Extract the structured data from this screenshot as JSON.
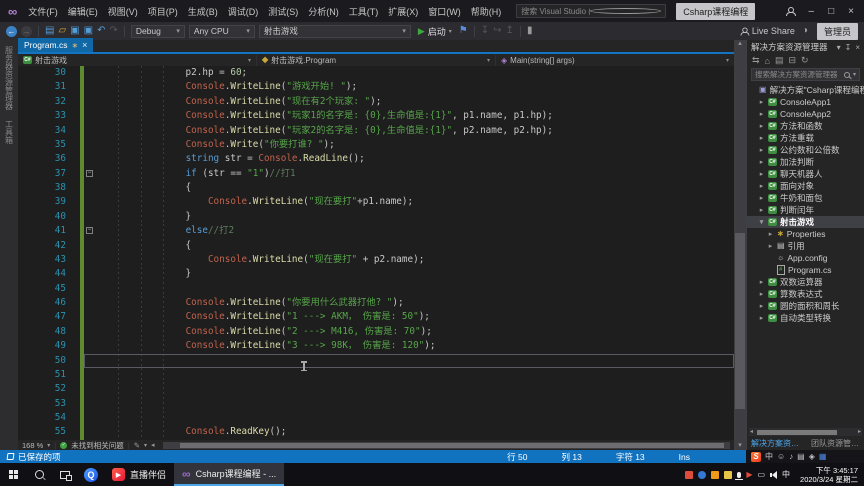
{
  "titlebar": {
    "menus": [
      "文件(F)",
      "编辑(E)",
      "视图(V)",
      "项目(P)",
      "生成(B)",
      "调试(D)",
      "测试(S)",
      "分析(N)",
      "工具(T)",
      "扩展(X)",
      "窗口(W)",
      "帮助(H)"
    ],
    "search_placeholder": "搜索 Visual Studio (Ctrl+Q)",
    "window_title": "Csharp课程编程",
    "minimize": "–",
    "maximize": "□",
    "close": "×"
  },
  "toolbar": {
    "config": "Debug",
    "platform": "Any CPU",
    "startup_project": "射击游戏",
    "start_label": "启动",
    "live_share_label": "Live Share",
    "admin_badge": "管理员"
  },
  "left_tabs": [
    "服务器资源管理器",
    "工具箱"
  ],
  "editor": {
    "tab": "Program.cs",
    "navbar": {
      "project": "射击游戏",
      "type": "射击游戏.Program",
      "member": "Main(string[] args)"
    },
    "zoom_level": "168 %",
    "health": "未找到相关问题",
    "lines": [
      {
        "n": 30,
        "t": [
          [
            "                p2.hp = ",
            "id"
          ],
          [
            "60",
            "num"
          ],
          [
            ";",
            "id"
          ]
        ]
      },
      {
        "n": 31,
        "t": [
          [
            "                ",
            "id"
          ],
          [
            "Console",
            "cls"
          ],
          [
            ".",
            "id"
          ],
          [
            "WriteLine",
            "mth"
          ],
          [
            "(",
            "id"
          ],
          [
            "\"游戏开始! \"",
            "str"
          ],
          [
            ");",
            "id"
          ]
        ]
      },
      {
        "n": 32,
        "t": [
          [
            "                ",
            "id"
          ],
          [
            "Console",
            "cls"
          ],
          [
            ".",
            "id"
          ],
          [
            "WriteLine",
            "mth"
          ],
          [
            "(",
            "id"
          ],
          [
            "\"现在有2个玩家: \"",
            "str"
          ],
          [
            ");",
            "id"
          ]
        ]
      },
      {
        "n": 33,
        "t": [
          [
            "                ",
            "id"
          ],
          [
            "Console",
            "cls"
          ],
          [
            ".",
            "id"
          ],
          [
            "WriteLine",
            "mth"
          ],
          [
            "(",
            "id"
          ],
          [
            "\"玩家1的名字是: {0},生命值是:{1}\"",
            "str"
          ],
          [
            ", p1.name, p1.hp);",
            "id"
          ]
        ]
      },
      {
        "n": 34,
        "t": [
          [
            "                ",
            "id"
          ],
          [
            "Console",
            "cls"
          ],
          [
            ".",
            "id"
          ],
          [
            "WriteLine",
            "mth"
          ],
          [
            "(",
            "id"
          ],
          [
            "\"玩家2的名字是: {0},生命值是:{1}\"",
            "str"
          ],
          [
            ", p2.name, p2.hp);",
            "id"
          ]
        ]
      },
      {
        "n": 35,
        "t": [
          [
            "                ",
            "id"
          ],
          [
            "Console",
            "cls"
          ],
          [
            ".",
            "id"
          ],
          [
            "Write",
            "mth"
          ],
          [
            "(",
            "id"
          ],
          [
            "\"你要打谁? \"",
            "str"
          ],
          [
            ");",
            "id"
          ]
        ]
      },
      {
        "n": 36,
        "t": [
          [
            "                ",
            "id"
          ],
          [
            "string",
            "kw"
          ],
          [
            " str = ",
            "id"
          ],
          [
            "Console",
            "cls"
          ],
          [
            ".",
            "id"
          ],
          [
            "ReadLine",
            "mth"
          ],
          [
            "();",
            "id"
          ]
        ]
      },
      {
        "n": 37,
        "fold": 1,
        "t": [
          [
            "                ",
            "id"
          ],
          [
            "if",
            "kw"
          ],
          [
            " (str == ",
            "id"
          ],
          [
            "\"1\"",
            "str"
          ],
          [
            ")",
            "id"
          ],
          [
            "//打1",
            "cmt"
          ]
        ]
      },
      {
        "n": 38,
        "t": [
          [
            "                {",
            "id"
          ]
        ]
      },
      {
        "n": 39,
        "t": [
          [
            "                    ",
            "id"
          ],
          [
            "Console",
            "cls"
          ],
          [
            ".",
            "id"
          ],
          [
            "WriteLine",
            "mth"
          ],
          [
            "(",
            "id"
          ],
          [
            "\"现在要打\"",
            "str"
          ],
          [
            "+p1.name);",
            "id"
          ]
        ]
      },
      {
        "n": 40,
        "t": [
          [
            "                }",
            "id"
          ]
        ]
      },
      {
        "n": 41,
        "fold": 1,
        "t": [
          [
            "                ",
            "id"
          ],
          [
            "else",
            "kw"
          ],
          [
            "//打2",
            "cmt"
          ]
        ]
      },
      {
        "n": 42,
        "t": [
          [
            "                {",
            "id"
          ]
        ]
      },
      {
        "n": 43,
        "t": [
          [
            "                    ",
            "id"
          ],
          [
            "Console",
            "cls"
          ],
          [
            ".",
            "id"
          ],
          [
            "WriteLine",
            "mth"
          ],
          [
            "(",
            "id"
          ],
          [
            "\"现在要打\"",
            "str"
          ],
          [
            " + p2.name);",
            "id"
          ]
        ]
      },
      {
        "n": 44,
        "t": [
          [
            "                }",
            "id"
          ]
        ]
      },
      {
        "n": 45,
        "t": []
      },
      {
        "n": 46,
        "t": [
          [
            "                ",
            "id"
          ],
          [
            "Console",
            "cls"
          ],
          [
            ".",
            "id"
          ],
          [
            "WriteLine",
            "mth"
          ],
          [
            "(",
            "id"
          ],
          [
            "\"你要用什么武器打他? \"",
            "str"
          ],
          [
            ");",
            "id"
          ]
        ]
      },
      {
        "n": 47,
        "t": [
          [
            "                ",
            "id"
          ],
          [
            "Console",
            "cls"
          ],
          [
            ".",
            "id"
          ],
          [
            "WriteLine",
            "mth"
          ],
          [
            "(",
            "id"
          ],
          [
            "\"1 ---> AKM， 伤害是: 50\"",
            "str"
          ],
          [
            ");",
            "id"
          ]
        ]
      },
      {
        "n": 48,
        "t": [
          [
            "                ",
            "id"
          ],
          [
            "Console",
            "cls"
          ],
          [
            ".",
            "id"
          ],
          [
            "WriteLine",
            "mth"
          ],
          [
            "(",
            "id"
          ],
          [
            "\"2 ---> M416, 伤害是: 70\"",
            "str"
          ],
          [
            ");",
            "id"
          ]
        ]
      },
      {
        "n": 49,
        "t": [
          [
            "                ",
            "id"
          ],
          [
            "Console",
            "cls"
          ],
          [
            ".",
            "id"
          ],
          [
            "WriteLine",
            "mth"
          ],
          [
            "(",
            "id"
          ],
          [
            "\"3 ---> 98K， 伤害是: 120\"",
            "str"
          ],
          [
            ");",
            "id"
          ]
        ]
      },
      {
        "n": 50,
        "cur": 1,
        "t": []
      },
      {
        "n": 51,
        "t": []
      },
      {
        "n": 52,
        "t": []
      },
      {
        "n": 53,
        "t": []
      },
      {
        "n": 54,
        "t": []
      },
      {
        "n": 55,
        "t": [
          [
            "                ",
            "id"
          ],
          [
            "Console",
            "cls"
          ],
          [
            ".",
            "id"
          ],
          [
            "ReadKey",
            "mth"
          ],
          [
            "();",
            "id"
          ]
        ]
      }
    ]
  },
  "solution_explorer": {
    "title": "解决方案资源管理器",
    "search_placeholder": "搜索解决方案资源管理器",
    "tree": [
      {
        "l": "解决方案\"Csharp课程编程\"",
        "i": "sol",
        "a": "",
        "d": 0
      },
      {
        "l": "ConsoleApp1",
        "i": "cs",
        "a": "c",
        "d": 1
      },
      {
        "l": "ConsoleApp2",
        "i": "cs",
        "a": "c",
        "d": 1
      },
      {
        "l": "方法和函数",
        "i": "cs",
        "a": "c",
        "d": 1
      },
      {
        "l": "方法重载",
        "i": "cs",
        "a": "c",
        "d": 1
      },
      {
        "l": "公约数和公倍数",
        "i": "cs",
        "a": "c",
        "d": 1
      },
      {
        "l": "加法判断",
        "i": "cs",
        "a": "c",
        "d": 1
      },
      {
        "l": "聊天机器人",
        "i": "cs",
        "a": "c",
        "d": 1
      },
      {
        "l": "面向对象",
        "i": "cs",
        "a": "c",
        "d": 1
      },
      {
        "l": "牛奶和面包",
        "i": "cs",
        "a": "c",
        "d": 1
      },
      {
        "l": "判断闰年",
        "i": "cs",
        "a": "c",
        "d": 1
      },
      {
        "l": "射击游戏",
        "i": "cs",
        "a": "e",
        "d": 1,
        "sel": 1
      },
      {
        "l": "Properties",
        "i": "wr",
        "a": "c",
        "d": 2
      },
      {
        "l": "引用",
        "i": "rf",
        "a": "c",
        "d": 2
      },
      {
        "l": "App.config",
        "i": "cfg",
        "a": "",
        "d": 2
      },
      {
        "l": "Program.cs",
        "i": "csfile",
        "a": "",
        "d": 2
      },
      {
        "l": "双数运算器",
        "i": "cs",
        "a": "c",
        "d": 1
      },
      {
        "l": "算数表达式",
        "i": "cs",
        "a": "c",
        "d": 1
      },
      {
        "l": "圆的面积和周长",
        "i": "cs",
        "a": "c",
        "d": 1
      },
      {
        "l": "自动类型转换",
        "i": "cs",
        "a": "c",
        "d": 1
      }
    ],
    "bottom_tabs": [
      {
        "label": "解决方案资源管理器",
        "active": true
      },
      {
        "label": "团队资源管理器",
        "active": false
      }
    ]
  },
  "statusbar": {
    "saved": "已保存的项",
    "line": "行 50",
    "column": "列 13",
    "character": "字符 13",
    "mode": "Ins"
  },
  "sogou_bar": {
    "logo": "S",
    "ime": "中",
    "icons": [
      "☺",
      "♪",
      "▤",
      "◈",
      "▦"
    ]
  },
  "taskbar": {
    "apps": [
      {
        "label": "直播伴侣"
      },
      {
        "label": "Csharp课程编程 - ..."
      }
    ],
    "ime": "中",
    "time": "下午 3:45:17",
    "date": "2020/3/24 星期二",
    "tray_colors": [
      "#E14B3C",
      "#3577D4",
      "#F09A1A",
      "#E8C547"
    ]
  },
  "colors": {
    "accent": "#1173C0",
    "tab_active": "#1168A7",
    "change_bar": "#5E8A32"
  }
}
